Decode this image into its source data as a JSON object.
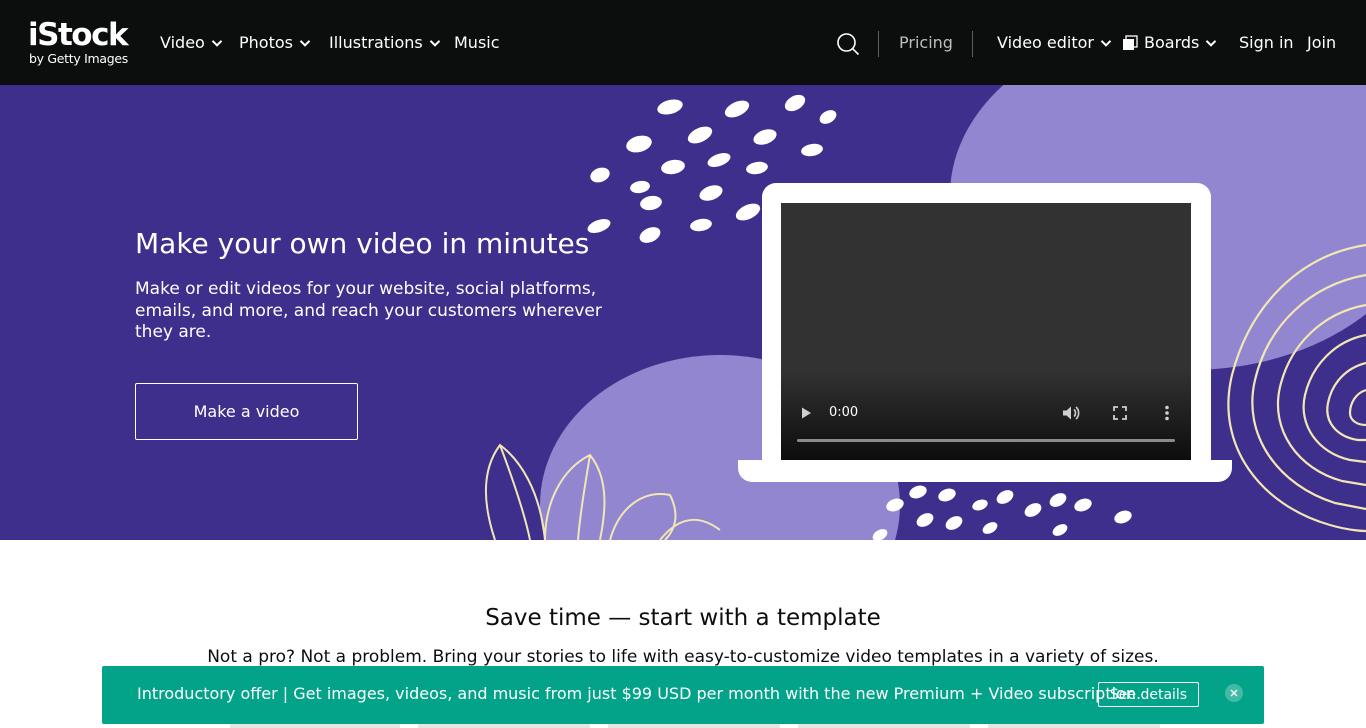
{
  "header": {
    "logo": {
      "name": "iStock",
      "tagline": "by Getty Images"
    },
    "nav": [
      {
        "label": "Video",
        "has_dropdown": true
      },
      {
        "label": "Photos",
        "has_dropdown": true
      },
      {
        "label": "Illustrations",
        "has_dropdown": true
      },
      {
        "label": "Music",
        "has_dropdown": false
      }
    ],
    "search_icon": "search-icon",
    "pricing": "Pricing",
    "video_editor": "Video editor",
    "boards": "Boards",
    "sign_in": "Sign in",
    "join": "Join"
  },
  "hero": {
    "title": "Make your own video in minutes",
    "description": "Make or edit videos for your website, social platforms, emails, and more, and reach your customers wherever they are.",
    "cta": "Make a video",
    "video": {
      "time": "0:00",
      "progress": 0
    }
  },
  "templates": {
    "title": "Save time — start with a template",
    "description": "Not a pro? Not a problem. Bring your stories to life with easy-to-customize video templates in a variety of sizes."
  },
  "banner": {
    "text": "Introductory offer | Get images, videos, and music from just $99 USD per month with the new Premium + Video subscription.",
    "button": "See details",
    "close_icon": "close-icon"
  },
  "colors": {
    "header_bg": "#0c0d0d",
    "hero_bg": "#3f2f8c",
    "hero_accent": "#9186cf",
    "banner_bg": "#02a388"
  }
}
